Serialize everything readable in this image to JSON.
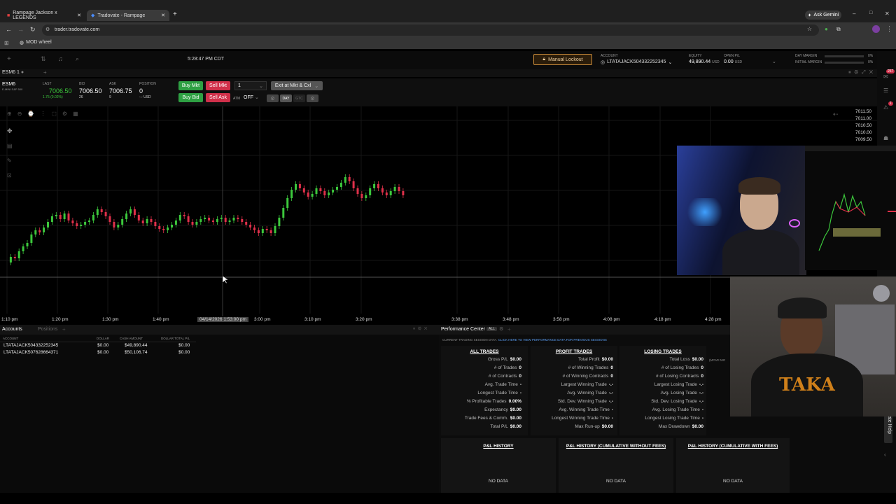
{
  "browser": {
    "tabs": [
      {
        "label": "Rampage Jackson x LEGENDS"
      },
      {
        "label": "Tradovate - Rampage"
      }
    ],
    "url": "trader.tradovate.com",
    "bookmark": "MOD wheel",
    "gemini": "Ask Gemini"
  },
  "header": {
    "clock": "5:28:47 PM CDT",
    "manual_lockout": "Manual Lockout",
    "account_label": "ACCOUNT",
    "account_value": "LTATAJACK504332252345",
    "equity_label": "EQUITY",
    "equity_value": "49,890.44",
    "equity_unit": "USD",
    "openpl_label": "OPEN P/L",
    "openpl_value": "0.00",
    "openpl_unit": "USD",
    "day_margin": "DAY MARGIN",
    "initial_margin": "INITIAL MARGIN",
    "margin_pct_1": "0%",
    "margin_pct_2": "0%"
  },
  "chart_header": {
    "symbol": "ESM6 1"
  },
  "order_bar": {
    "symbol": "ESM6",
    "symbol_sub": "E-MINI S&P 500",
    "last_label": "LAST",
    "last": "7006.50",
    "change": "1.75 (0.02%)",
    "bid_label": "BID",
    "bid": "7006.50",
    "bid_size": "26",
    "ask_label": "ASK",
    "ask": "7006.75",
    "ask_size": "9",
    "position_label": "POSITION",
    "position": "0",
    "position_sub": "-.- USD",
    "buy_mkt": "Buy Mkt",
    "sell_mkt": "Sell Mkt",
    "qty": "1",
    "exit": "Exit at Mkt & Cxl",
    "buy_bid": "Buy Bid",
    "sell_ask": "Sell Ask",
    "atm": "ATM",
    "atm_value": "OFF",
    "day": "DAY",
    "gtc": "GTC"
  },
  "chart_data": {
    "type": "candlestick",
    "price_ticks": [
      "7011.50",
      "7011.00",
      "7010.50",
      "7010.00",
      "7009.50"
    ],
    "time_ticks": [
      "1:10 pm",
      "1:20 pm",
      "1:30 pm",
      "1:40 pm",
      "04/14/2026 1:53:00 pm",
      "3:00 pm",
      "3:10 pm",
      "3:20 pm",
      "3:38 pm",
      "3:48 pm",
      "3:58 pm",
      "4:08 pm",
      "4:18 pm",
      "4:28 pm"
    ],
    "series": [
      12,
      20,
      18,
      28,
      35,
      40,
      52,
      58,
      55,
      62,
      70,
      78,
      80,
      74,
      82,
      72,
      68,
      64,
      66,
      70,
      72,
      80,
      88,
      84,
      78,
      70,
      62,
      66,
      74,
      82,
      88,
      80,
      72,
      68,
      74,
      70,
      64,
      60,
      58,
      62,
      66,
      72,
      80,
      78,
      70,
      66,
      70,
      74,
      76,
      72,
      70,
      74,
      76,
      70,
      72,
      76,
      74,
      70,
      66,
      62,
      58,
      54,
      60,
      58,
      54,
      64,
      76,
      90,
      104,
      116,
      124,
      118,
      112,
      106,
      110,
      118,
      114,
      108,
      112,
      116,
      120,
      126,
      134,
      128,
      118,
      110,
      104,
      108,
      118,
      124,
      118,
      112,
      108,
      114,
      120,
      114,
      108
    ],
    "colors": {
      "up": "#3cc83c",
      "down": "#e0304a"
    }
  },
  "accounts": {
    "tab_accounts": "Accounts",
    "tab_positions": "Positions",
    "columns": [
      "ACCOUNT",
      "DOLLAR",
      "CASH AMOUNT",
      "DOLLAR TOTAL P/L"
    ],
    "rows": [
      [
        "LTATAJACK504332252345",
        "$0.00",
        "$49,890.44",
        "$0.00"
      ],
      [
        "LTATAJACK507628664371",
        "$0.00",
        "$50,106.74",
        "$0.00"
      ]
    ]
  },
  "performance": {
    "title": "Performance Center",
    "all_badge": "ALL",
    "session_note": "CURRENT TRADING SESSION DATA.",
    "session_link": "CLICK HERE TO VIEW PERFORMANCE DATA FOR PREVIOUS SESSIONS",
    "all_trades": {
      "title": "ALL TRADES",
      "rows": [
        [
          "Gross P/L",
          "$0.00"
        ],
        [
          "# of Trades",
          "0"
        ],
        [
          "# of Contracts",
          "0"
        ],
        [
          "Avg. Trade Time",
          "-"
        ],
        [
          "Longest Trade Time",
          "-"
        ],
        [
          "% Profitable Trades",
          "0.00%"
        ],
        [
          "Expectancy",
          "$0.00"
        ],
        [
          "Trade Fees & Comm.",
          "$0.00"
        ],
        [
          "Total P/L",
          "$0.00"
        ]
      ]
    },
    "profit_trades": {
      "title": "PROFIT TRADES",
      "rows": [
        [
          "Total Profit",
          "$0.00"
        ],
        [
          "# of Winning Trades",
          "0"
        ],
        [
          "# of Winning Contracts",
          "0"
        ],
        [
          "Largest Winning Trade",
          "-.-"
        ],
        [
          "Avg. Winning Trade",
          "-.-"
        ],
        [
          "Std. Dev. Winning Trade",
          "-.-"
        ],
        [
          "Avg. Winning Trade Time",
          "-"
        ],
        [
          "Longest Winning Trade Time",
          "-"
        ],
        [
          "Max Run-up",
          "$0.00"
        ]
      ]
    },
    "losing_trades": {
      "title": "LOSING TRADES",
      "rows": [
        [
          "Total Loss",
          "$0.00"
        ],
        [
          "# of Losing Trades",
          "0"
        ],
        [
          "# of Losing Contracts",
          "0"
        ],
        [
          "Largest Losing Trade",
          "-.-"
        ],
        [
          "Avg. Losing Trade",
          "-.-"
        ],
        [
          "Std. Dev. Losing Trade",
          "-.-"
        ],
        [
          "Avg. Losing Trade Time",
          "-"
        ],
        [
          "Longest Losing Trade Time",
          "-"
        ],
        [
          "Max Drawdown",
          "$0.00"
        ]
      ]
    },
    "move_mode": "(MOVE MO",
    "pl_history": "P&L HISTORY",
    "pl_cum_no_fees": "P&L HISTORY (CUMULATIVE WITHOUT FEES)",
    "pl_cum_fees": "P&L HISTORY (CUMULATIVE WITH FEES)",
    "no_data": "NO DATA"
  },
  "sidebar": {
    "badge1": "257",
    "badge2": "1",
    "help": "lovate Help"
  }
}
